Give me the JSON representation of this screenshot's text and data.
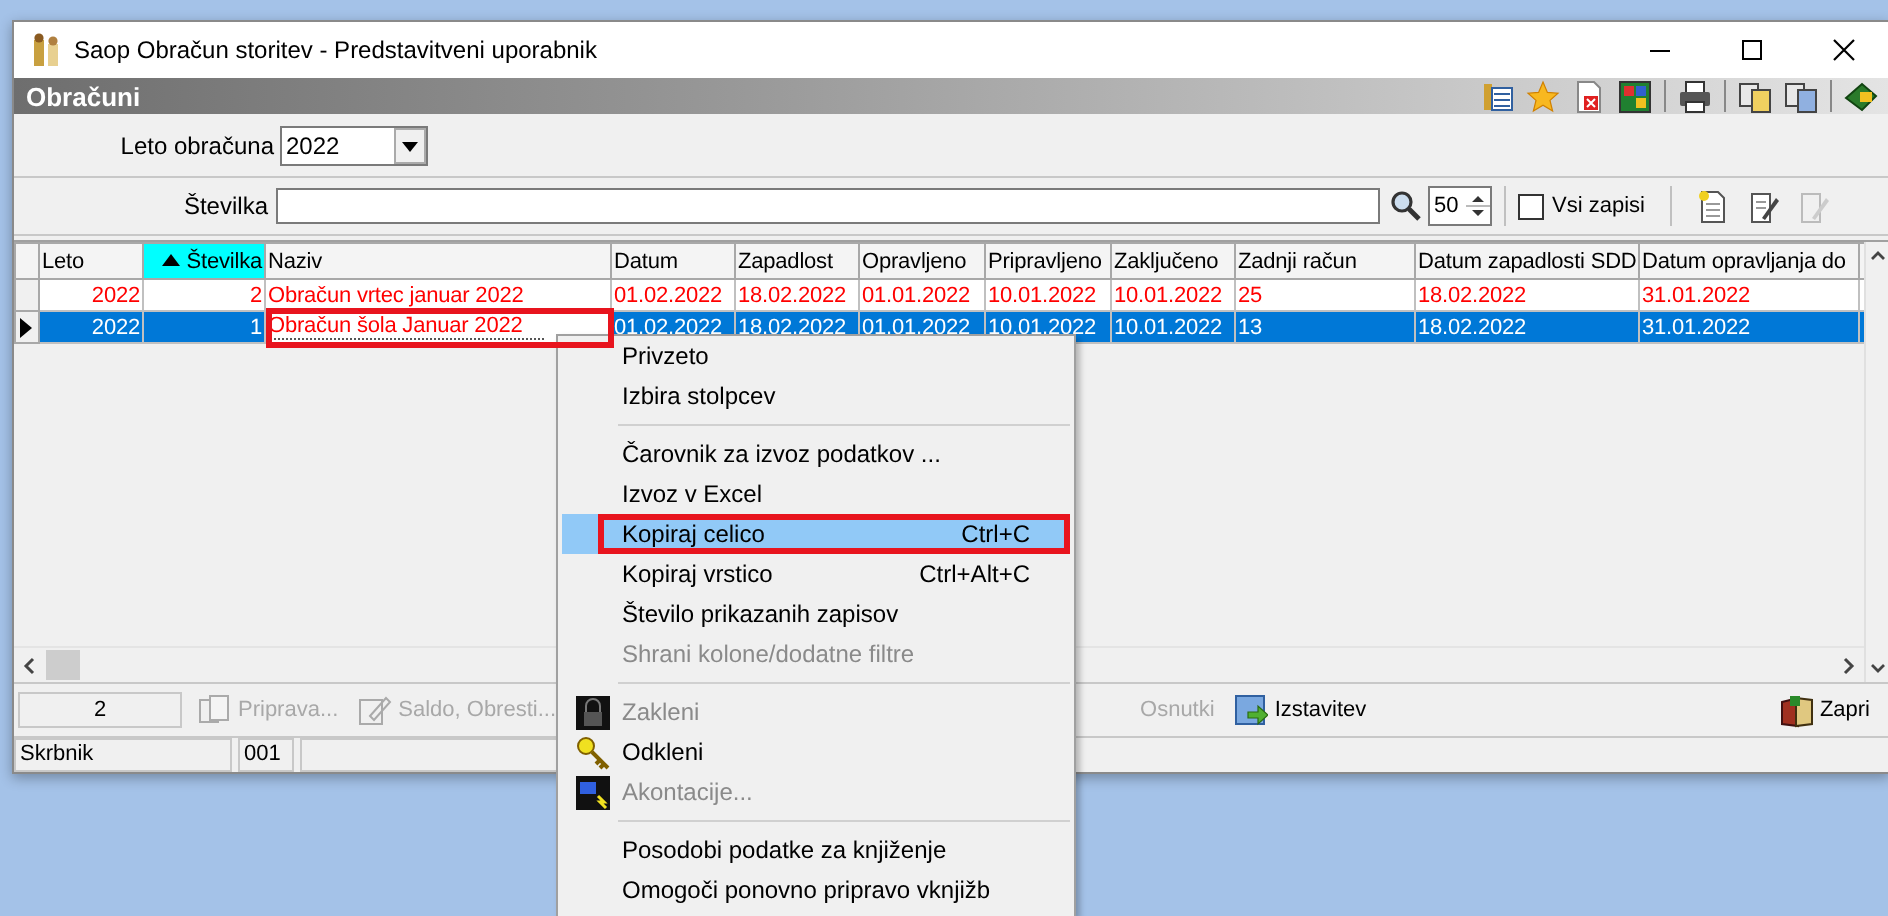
{
  "window": {
    "title": "Saop Obračun storitev - Predstavitveni uporabnik"
  },
  "panel": {
    "title": "Obračuni"
  },
  "filters": {
    "year": {
      "label": "Leto obračuna",
      "value": "2022"
    },
    "number": {
      "label": "Številka"
    },
    "page_size": "50",
    "all_records": {
      "label": "Vsi zapisi",
      "checked": false
    }
  },
  "table": {
    "columns": [
      {
        "label": "Leto",
        "sorted": false
      },
      {
        "label": "Številka",
        "sorted": true
      },
      {
        "label": "Naziv",
        "sorted": false
      },
      {
        "label": "Datum",
        "sorted": false
      },
      {
        "label": "Zapadlost",
        "sorted": false
      },
      {
        "label": "Opravljeno",
        "sorted": false
      },
      {
        "label": "Pripravljeno",
        "sorted": false
      },
      {
        "label": "Zaključeno",
        "sorted": false
      },
      {
        "label": "Zadnji račun",
        "sorted": false
      },
      {
        "label": "Datum zapadlosti SDD",
        "sorted": false
      },
      {
        "label": "Datum opravljanja do",
        "sorted": false
      }
    ],
    "rows": [
      {
        "selected": false,
        "editing": false,
        "cells": [
          "2022",
          "2",
          "Obračun vrtec januar 2022",
          "01.02.2022",
          "18.02.2022",
          "01.01.2022",
          "10.01.2022",
          "10.01.2022",
          "25",
          "18.02.2022",
          "31.01.2022"
        ]
      },
      {
        "selected": true,
        "editing": true,
        "annotated": true,
        "cells": [
          "2022",
          "1",
          "Obračun šola Januar 2022",
          "01.02.2022",
          "18.02.2022",
          "01.01.2022",
          "10.01.2022",
          "10.01.2022",
          "13",
          "18.02.2022",
          "31.01.2022"
        ]
      }
    ]
  },
  "record_count": "2",
  "buttons": [
    {
      "kind": "prepare",
      "label": "Priprava...",
      "disabled": true
    },
    {
      "kind": "balance",
      "label": "Saldo, Obresti...",
      "disabled": true
    },
    {
      "kind": "drafts",
      "label": "Osnutki",
      "disabled": true
    },
    {
      "kind": "issue",
      "label": "Izstavitev",
      "disabled": false
    },
    {
      "kind": "close",
      "label": "Zapri",
      "disabled": false
    }
  ],
  "status_bar": [
    "Skrbnik",
    "001"
  ],
  "context_menu": [
    {
      "kind": "item",
      "label": "Privzeto",
      "disabled": false,
      "selected": false
    },
    {
      "kind": "item",
      "label": "Izbira stolpcev",
      "disabled": false,
      "selected": false
    },
    {
      "kind": "separator"
    },
    {
      "kind": "item",
      "label": "Čarovnik za izvoz podatkov ...",
      "disabled": false,
      "selected": false
    },
    {
      "kind": "item",
      "label": "Izvoz v Excel",
      "disabled": false,
      "selected": false
    },
    {
      "kind": "item",
      "label": "Kopiraj celico",
      "shortcut": "Ctrl+C",
      "disabled": false,
      "selected": true,
      "annotated": true
    },
    {
      "kind": "item",
      "label": "Kopiraj vrstico",
      "shortcut": "Ctrl+Alt+C",
      "disabled": false,
      "selected": false
    },
    {
      "kind": "item",
      "label": "Število prikazanih zapisov",
      "disabled": false,
      "selected": false
    },
    {
      "kind": "item",
      "label": "Shrani kolone/dodatne filtre",
      "disabled": true,
      "selected": false
    },
    {
      "kind": "separator"
    },
    {
      "kind": "lock",
      "label": "Zakleni",
      "disabled": true,
      "selected": false
    },
    {
      "kind": "key",
      "label": "Odkleni",
      "disabled": false,
      "selected": false
    },
    {
      "kind": "advance",
      "label": "Akontacije...",
      "disabled": true,
      "selected": false
    },
    {
      "kind": "separator"
    },
    {
      "kind": "item",
      "label": "Posodobi podatke za knjiženje",
      "disabled": false,
      "selected": false
    },
    {
      "kind": "item",
      "label": "Omogoči ponovno pripravo vknjižb",
      "disabled": false,
      "selected": false
    }
  ]
}
